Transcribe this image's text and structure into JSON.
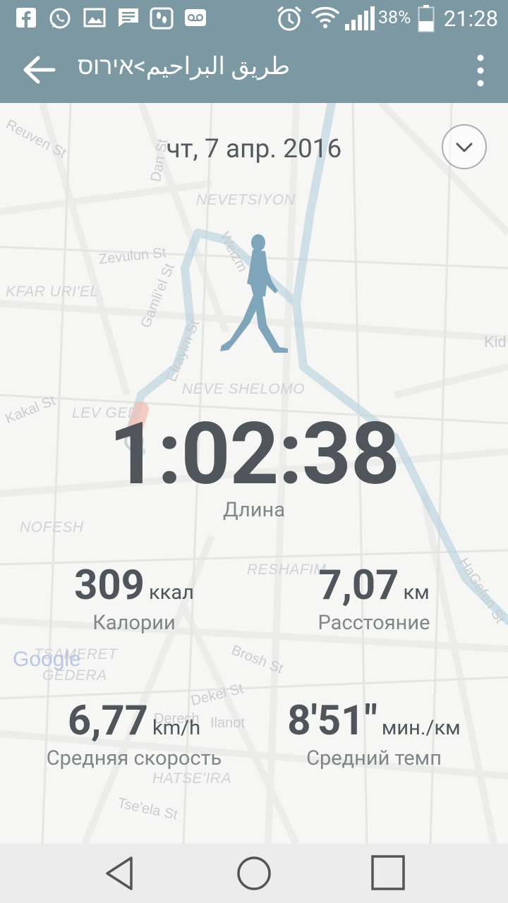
{
  "status_bar": {
    "time": "21:28",
    "battery_percent": "38%",
    "icons": [
      "facebook-icon",
      "whatsapp-icon",
      "gallery-icon",
      "message-icon",
      "pedometer-icon",
      "voicemail-icon",
      "alarm-icon",
      "wifi-icon",
      "signal-icon",
      "battery-icon"
    ]
  },
  "toolbar": {
    "title": "طريق البراحيم>אירוס",
    "back_icon": "arrow-left-icon",
    "more_icon": "more-vertical-icon"
  },
  "activity": {
    "date": "чт, 7 апр. 2016",
    "duration": "1:02:38",
    "duration_label": "Длина",
    "calories": {
      "value": "309",
      "unit": "ккал",
      "label": "Калории"
    },
    "distance": {
      "value": "7,07",
      "unit": "км",
      "label": "Расстояние"
    },
    "avg_speed": {
      "value": "6,77",
      "unit": "km/h",
      "label": "Средняя скорость"
    },
    "avg_pace": {
      "value": "8'51\"",
      "unit": "мин./км",
      "label": "Средний темп"
    }
  },
  "map": {
    "labels": {
      "reuven": "Reuven St",
      "dan": "Dan St",
      "nevetsiyon": "NEVETSIYON",
      "zevulun": "Zevulun St",
      "weizm": "Weizm",
      "kfar_uriel": "KFAR URI'EL",
      "gamliel": "Gamli'el St",
      "efrayim": "Efrayim St",
      "kid": "Kid",
      "neve_shelomo": "NEVE SHELOMO",
      "kakal": "Kakal St",
      "lev_ged": "LEV GED",
      "nofesh": "NOFESH",
      "reshafim": "RESHAFIM",
      "hagefen": "HaGefen St",
      "google": "Google",
      "tsameret": "TSAMERET",
      "gesera": "GEDERA",
      "brosh": "Brosh St",
      "dekel": "Dekel St",
      "derech": "Derech",
      "ilanot": "Ilanot",
      "hatseira": "HATSE'IRA",
      "tseela": "Tse'ela St"
    },
    "route_color": "#9cc0d2"
  },
  "colors": {
    "accent": "#7b98a3",
    "walker": "#7fa5bb",
    "text_dark": "#4f555a",
    "text_muted": "#80868a"
  },
  "nav_bar": {
    "back_icon": "nav-back-icon",
    "home_icon": "nav-home-icon",
    "recents_icon": "nav-recents-icon"
  }
}
